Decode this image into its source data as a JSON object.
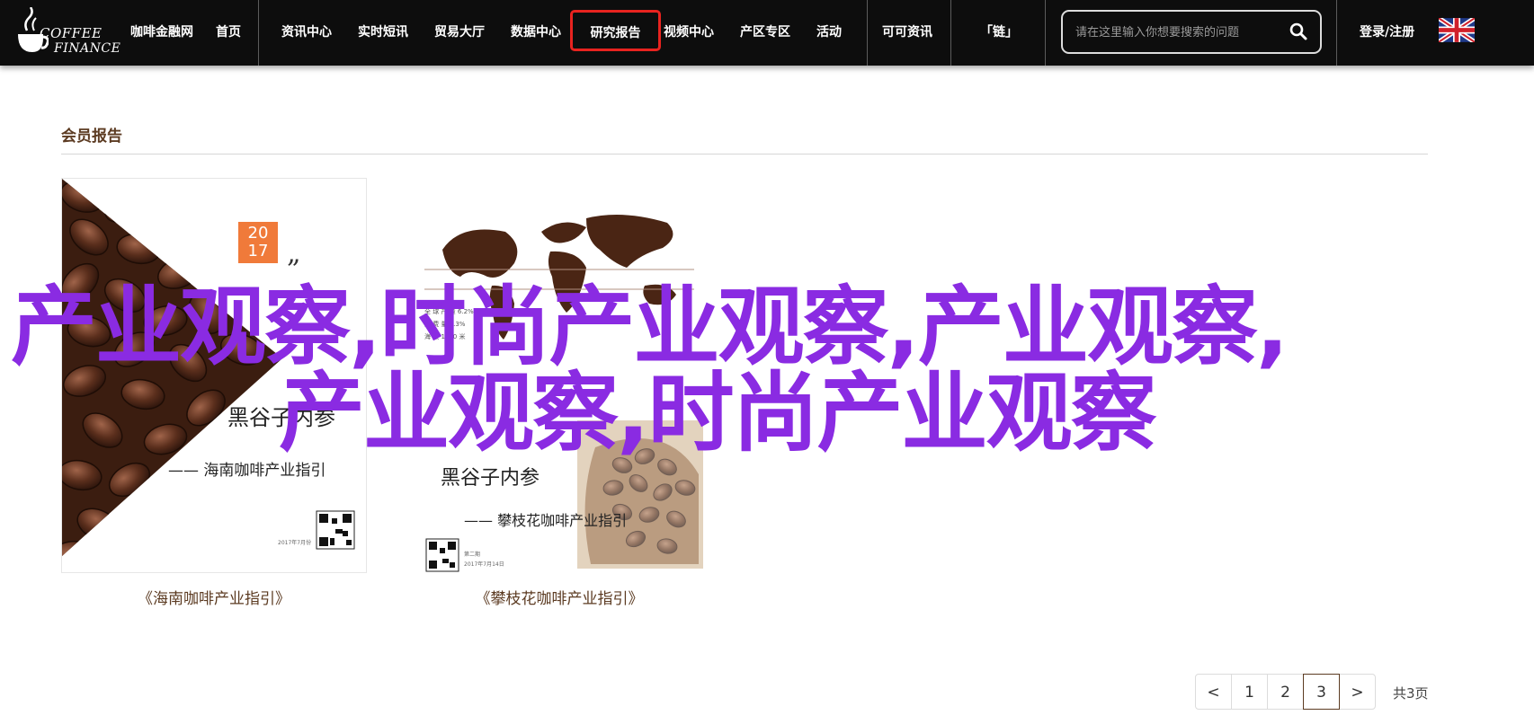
{
  "logo": {
    "line1": "COFFEE",
    "line2": "FINANCE"
  },
  "nav": {
    "items": [
      "咖啡金融网",
      "首页",
      "资讯中心",
      "实时短讯",
      "贸易大厅",
      "数据中心",
      "研究报告",
      "视频中心",
      "产区专区",
      "活动",
      "可可资讯",
      "「链」"
    ],
    "active": "研究报告",
    "login": "登录/注册"
  },
  "search": {
    "placeholder": "请在这里输入你想要搜索的问题"
  },
  "section": {
    "title": "会员报告"
  },
  "cards": [
    {
      "year_top": "20",
      "year_bottom": "17",
      "quote": "„",
      "title_big": "黑谷子内参",
      "subtitle": "—— 海南咖啡产业指引",
      "qr_date": "2017年7月份",
      "caption": "《海南咖啡产业指引》"
    },
    {
      "stat_line1": "全 球 产 量 6.2%",
      "stat_line2": "消 费 量 4.3%",
      "stat_line3": "海 拔 1500 米",
      "title_big": "黑谷子内参",
      "subtitle": "—— 攀枝花咖啡产业指引",
      "qr_label": "第二期",
      "qr_date": "2017年7月14日",
      "caption": "《攀枝花咖啡产业指引》"
    }
  ],
  "overlay": {
    "line1": "产业观察,时尚产业观察,产业观察,",
    "line2": "产业观察,时尚产业观察"
  },
  "pagination": {
    "prev": "<",
    "pages": [
      "1",
      "2",
      "3"
    ],
    "current": "3",
    "next": ">",
    "total": "共3页"
  },
  "colors": {
    "accent_red": "#e8231f",
    "brown_text": "#5c3b22",
    "overlay_purple": "#8a2be2",
    "badge_orange": "#f07a3a"
  }
}
